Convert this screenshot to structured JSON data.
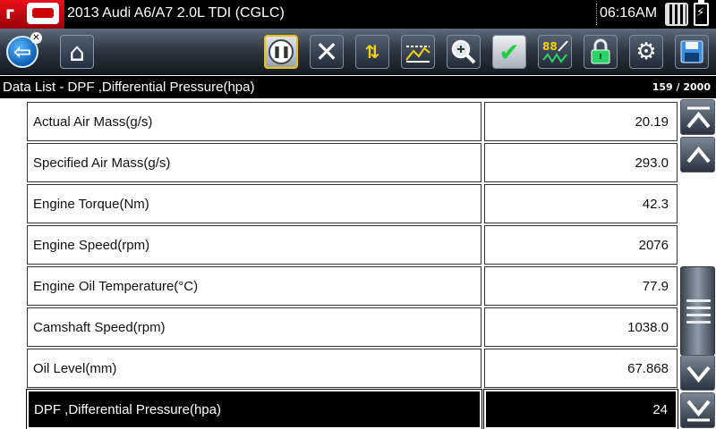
{
  "header": {
    "vehicle": "2013 Audi A6/A7 2.0L TDI (CGLC)",
    "time": "06:16AM"
  },
  "toolbar": {
    "buttons": [
      "back-icon",
      "home-icon",
      "pause-icon",
      "close-icon",
      "sort-icon",
      "graph-icon",
      "zoom-icon",
      "check-icon",
      "units-icon",
      "lock-icon",
      "settings-icon",
      "save-icon"
    ],
    "units_glyph": "88"
  },
  "subheader": {
    "title": "Data List - DPF ,Differential Pressure(hpa)",
    "page_count": "159 / 2000"
  },
  "rows": [
    {
      "name": "Actual Air Mass(g/s)",
      "value": "20.19"
    },
    {
      "name": "Specified Air Mass(g/s)",
      "value": "293.0"
    },
    {
      "name": "Engine Torque(Nm)",
      "value": "42.3"
    },
    {
      "name": "Engine Speed(rpm)",
      "value": "2076"
    },
    {
      "name": "Engine Oil Temperature(°C)",
      "value": "77.9"
    },
    {
      "name": "Camshaft Speed(rpm)",
      "value": "1038.0"
    },
    {
      "name": "Oil Level(mm)",
      "value": "67.868"
    },
    {
      "name": "DPF ,Differential Pressure(hpa)",
      "value": "24",
      "selected": true
    }
  ],
  "scroll_position": 0.079
}
